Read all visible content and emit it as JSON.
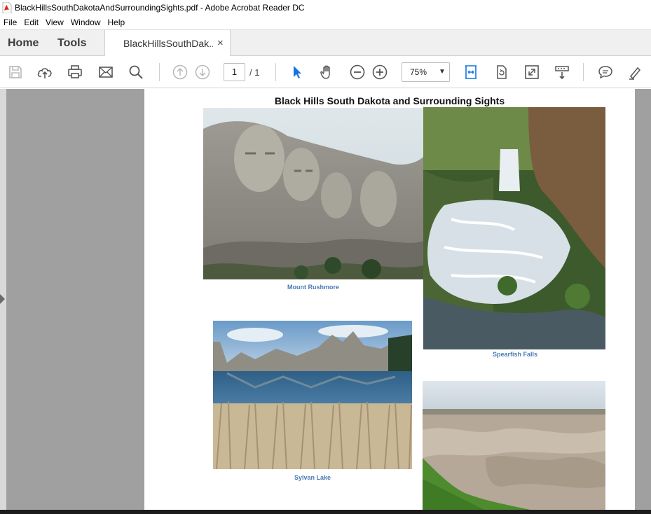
{
  "window": {
    "title": "BlackHillsSouthDakotaAndSurroundingSights.pdf - Adobe Acrobat Reader DC"
  },
  "menu": [
    "File",
    "Edit",
    "View",
    "Window",
    "Help"
  ],
  "tabs": {
    "home": "Home",
    "tools": "Tools",
    "document": "BlackHillsSouthDak...",
    "close_glyph": "×"
  },
  "toolbar": {
    "page_current": "1",
    "page_total": "/ 1",
    "zoom": "75%",
    "icons": [
      "save-icon",
      "cloud-upload-icon",
      "print-icon",
      "email-icon",
      "search-icon",
      "prev-page-icon",
      "next-page-icon",
      "select-cursor-icon",
      "hand-tool-icon",
      "zoom-out-icon",
      "zoom-in-icon",
      "fit-page-icon",
      "rotate-icon",
      "full-screen-icon",
      "scroll-mode-icon",
      "comment-icon",
      "highlight-icon"
    ],
    "accent": "#1473e6"
  },
  "document": {
    "title": "Black Hills South Dakota and Surrounding Sights",
    "captions": {
      "rushmore": "Mount Rushmore",
      "spearfish": "Spearfish Falls",
      "sylvan": "Sylvan Lake"
    },
    "caption_color": "#4a79b5"
  }
}
